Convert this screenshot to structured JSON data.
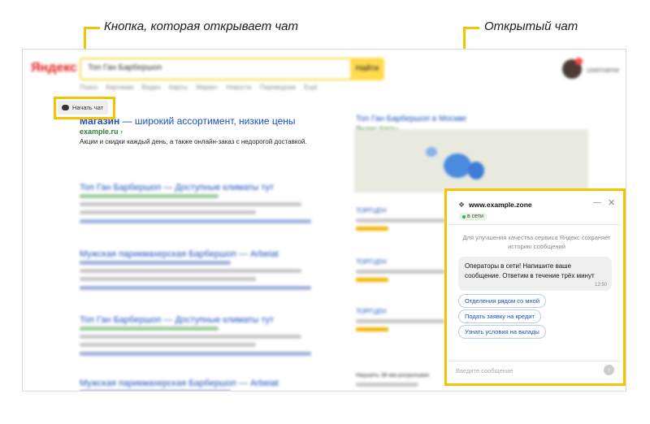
{
  "callouts": {
    "left": "Кнопка, которая открывает чат",
    "right": "Открытый чат"
  },
  "header": {
    "logo": "Яндекс",
    "search_query": "Топ Ган Барбершоп",
    "search_button": "Найти",
    "username": "username"
  },
  "nav_tabs": [
    "Поиск",
    "Картинки",
    "Видео",
    "Карты",
    "Маркет",
    "Новости",
    "Переводчик",
    "Ещё"
  ],
  "ad": {
    "title_bold": "Магазин",
    "title_rest": " — широкий ассортимент, низкие цены",
    "url": "example.ru",
    "description": "Акции и скидки каждый день, а также онлайн-заказ с недорогой доставкой.",
    "chat_button": "Начать чат"
  },
  "results": [
    {
      "title": "Топ Ган Барбершоп — Доступные климаты тут"
    },
    {
      "title": "Мужская парикмахерская Барбершоп — Arbeiat"
    },
    {
      "title": "Топ Ган Барбершоп — Доступные климаты тут"
    },
    {
      "title": "Мужская парикмахерская Барбершоп — Arbeiat"
    }
  ],
  "sidebar": {
    "title": "Топ Ган Барбершоп в Москве",
    "subtitle": "Яндекс.Карты",
    "places": [
      "ТОРГЦЕН",
      "ТОРГЦЕН",
      "ТОРГЦЕН"
    ],
    "footer": "Наушить 38 мм росрольвин"
  },
  "chat": {
    "site": "www.example.zone",
    "status": "в сети",
    "notice": "Для улучшения качества сервиса Яндекс сохраняет историю сообщений",
    "message": "Операторы в сети! Напишите ваше сообщение. Ответим в течение трёх минут",
    "time": "12:50",
    "quick_replies": [
      "Отделения рядом со мной",
      "Подать заявку на кредит",
      "Узнать условия на вклады"
    ],
    "input_placeholder": "Введите сообщение"
  },
  "colors": {
    "highlight": "#f5c400",
    "link": "#1a4fbd",
    "url_green": "#2e7d32",
    "online": "#2fb25b"
  }
}
